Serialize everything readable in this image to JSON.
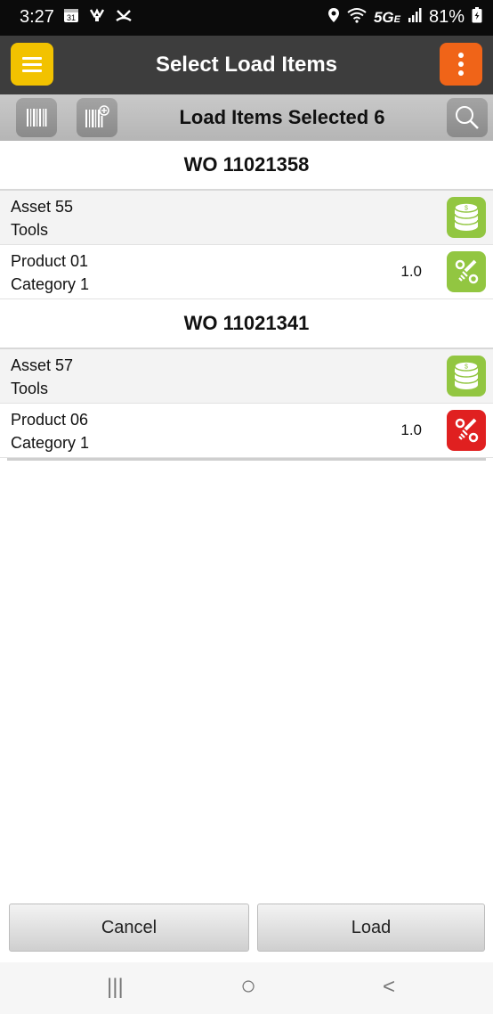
{
  "status_bar": {
    "time": "3:27",
    "left_icons": [
      "calendar-icon",
      "voicemail-icon",
      "missed-call-icon"
    ],
    "network": "5G",
    "network_sub": "E",
    "battery": "81%"
  },
  "header": {
    "title": "Select Load Items",
    "menu_icon": "hamburger-icon",
    "more_icon": "more-vert-icon",
    "menu_color": "#f2c200",
    "more_color": "#f06418"
  },
  "toolbar": {
    "title": "Load Items Selected 6",
    "barcode_icon": "barcode-icon",
    "barcode_add_icon": "barcode-add-icon",
    "search_icon": "search-icon"
  },
  "groups": [
    {
      "title": "WO 11021358",
      "asset": {
        "name": "Asset 55",
        "type": "Tools",
        "icon": "coins-icon",
        "color": "#92c641"
      },
      "product": {
        "name": "Product 01",
        "category": "Category 1",
        "qty": "1.0",
        "icon": "parts-icon",
        "color": "#92c641"
      }
    },
    {
      "title": "WO 11021341",
      "asset": {
        "name": "Asset 57",
        "type": "Tools",
        "icon": "coins-icon",
        "color": "#92c641"
      },
      "product": {
        "name": "Product 06",
        "category": "Category 1",
        "qty": "1.0",
        "icon": "parts-icon",
        "color": "#e02020"
      }
    }
  ],
  "actions": {
    "cancel": "Cancel",
    "load": "Load"
  },
  "nav": {
    "recents": "|||",
    "home": "○",
    "back": "<"
  }
}
